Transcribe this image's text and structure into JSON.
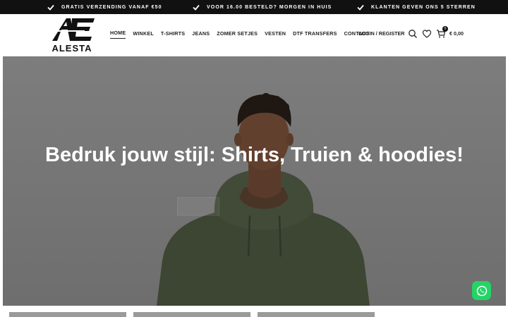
{
  "topbar": {
    "usps": [
      "GRATIS VERZENDING VANAF €50",
      "VOOR 16.00 BESTELD? MORGEN IN HUIS",
      "KLANTEN GEVEN ONS 5 STERREN"
    ],
    "check_icon": "check-icon"
  },
  "brand": {
    "name": "ALESTA",
    "mark": "AE"
  },
  "nav": {
    "items": [
      "HOME",
      "WINKEL",
      "T-SHIRTS",
      "JEANS",
      "ZOMER SETJES",
      "VESTEN",
      "DTF TRANSFERS",
      "CONTACT"
    ],
    "active": "HOME"
  },
  "header_actions": {
    "login": "LOGIN / REGISTER",
    "cart_count": "0",
    "cart_total": "€ 0,00",
    "icons": [
      "search-icon",
      "heart-icon",
      "cart-icon"
    ]
  },
  "hero": {
    "title": "Bedruk jouw stijl: Shirts, Truien & hoodies!"
  },
  "colors": {
    "topbar_bg": "#111111",
    "accent": "#222222",
    "whatsapp": "#25d366",
    "hoodie": "#3c4633"
  }
}
